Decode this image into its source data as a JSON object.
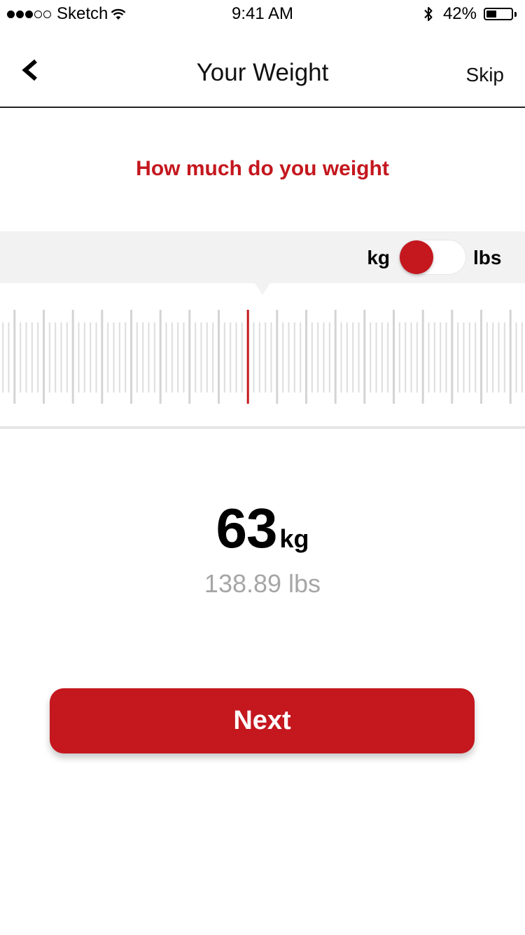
{
  "status_bar": {
    "carrier": "Sketch",
    "time": "9:41 AM",
    "battery_percent": "42%",
    "battery_level": 0.42,
    "signal_bars_filled": 3,
    "signal_bars_total": 5,
    "icons": [
      "wifi-icon",
      "bluetooth-icon",
      "battery-icon"
    ]
  },
  "nav": {
    "title": "Your Weight",
    "skip_label": "Skip",
    "back_icon": "chevron-left-icon"
  },
  "question": "How much do you weight",
  "unit_toggle": {
    "left_label": "kg",
    "right_label": "lbs",
    "selected": "kg"
  },
  "ruler": {
    "selected_value": 63,
    "unit": "kg",
    "visible_range": [
      54.5,
      72.5
    ],
    "ticks_per_unit": 5
  },
  "weight": {
    "value": "63",
    "unit": "kg",
    "converted": "138.89 lbs"
  },
  "next_label": "Next",
  "colors": {
    "accent": "#c4171e",
    "unit_bar_bg": "#f2f2f2",
    "tick": "#dddddd",
    "secondary_text": "#a6a6a6"
  }
}
